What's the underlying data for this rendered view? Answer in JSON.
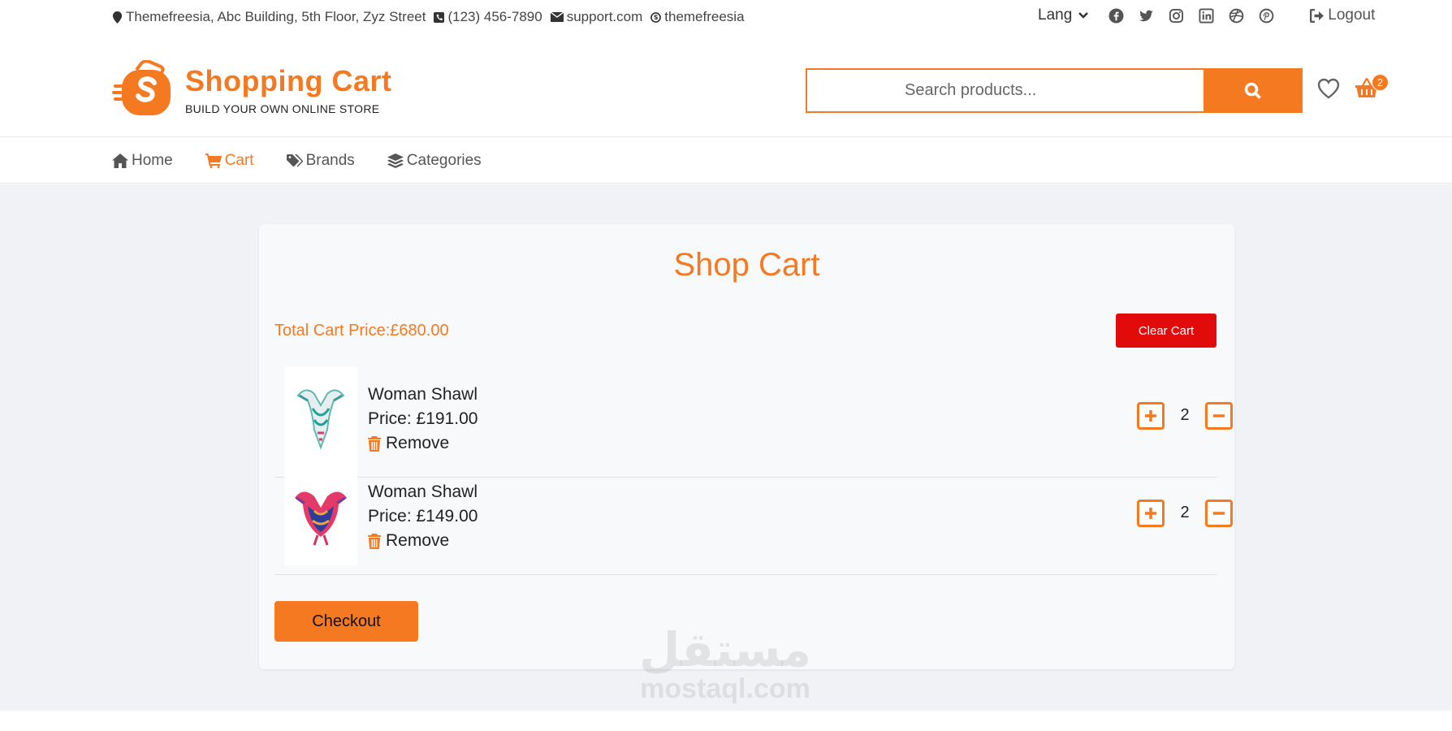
{
  "topbar": {
    "address": "Themefreesia, Abc Building, 5th Floor, Zyz Street",
    "phone": "(123) 456-7890",
    "email": "support.com",
    "skype": "themefreesia",
    "lang_label": "Lang",
    "logout_label": "Logout",
    "socials": [
      "facebook-icon",
      "twitter-icon",
      "instagram-icon",
      "linkedin-icon",
      "dribbble-icon",
      "pinterest-icon"
    ]
  },
  "brand": {
    "title": "Shopping Cart",
    "subtitle": "BUILD YOUR OWN ONLINE STORE",
    "accent_color": "#f47920"
  },
  "search": {
    "placeholder": "Search products..."
  },
  "header": {
    "cart_count": "2"
  },
  "nav": {
    "items": [
      {
        "label": "Home",
        "icon": "home-icon",
        "active": false
      },
      {
        "label": "Cart",
        "icon": "cart-icon",
        "active": true
      },
      {
        "label": "Brands",
        "icon": "tags-icon",
        "active": false
      },
      {
        "label": "Categories",
        "icon": "layers-icon",
        "active": false
      }
    ]
  },
  "cart": {
    "title": "Shop Cart",
    "total_label": "Total Cart Price:£680.00",
    "clear_label": "Clear Cart",
    "checkout_label": "Checkout",
    "remove_label": "Remove",
    "items": [
      {
        "name": "Woman Shawl",
        "price": "Price: £191.00",
        "qty": "2"
      },
      {
        "name": "Woman Shawl",
        "price": "Price: £149.00",
        "qty": "2"
      }
    ]
  },
  "watermark": {
    "arabic": "مستقل",
    "latin": "mostaql.com"
  },
  "colors": {
    "accent": "#f47920",
    "danger": "#e20b0b",
    "background": "#f1f2f5"
  }
}
